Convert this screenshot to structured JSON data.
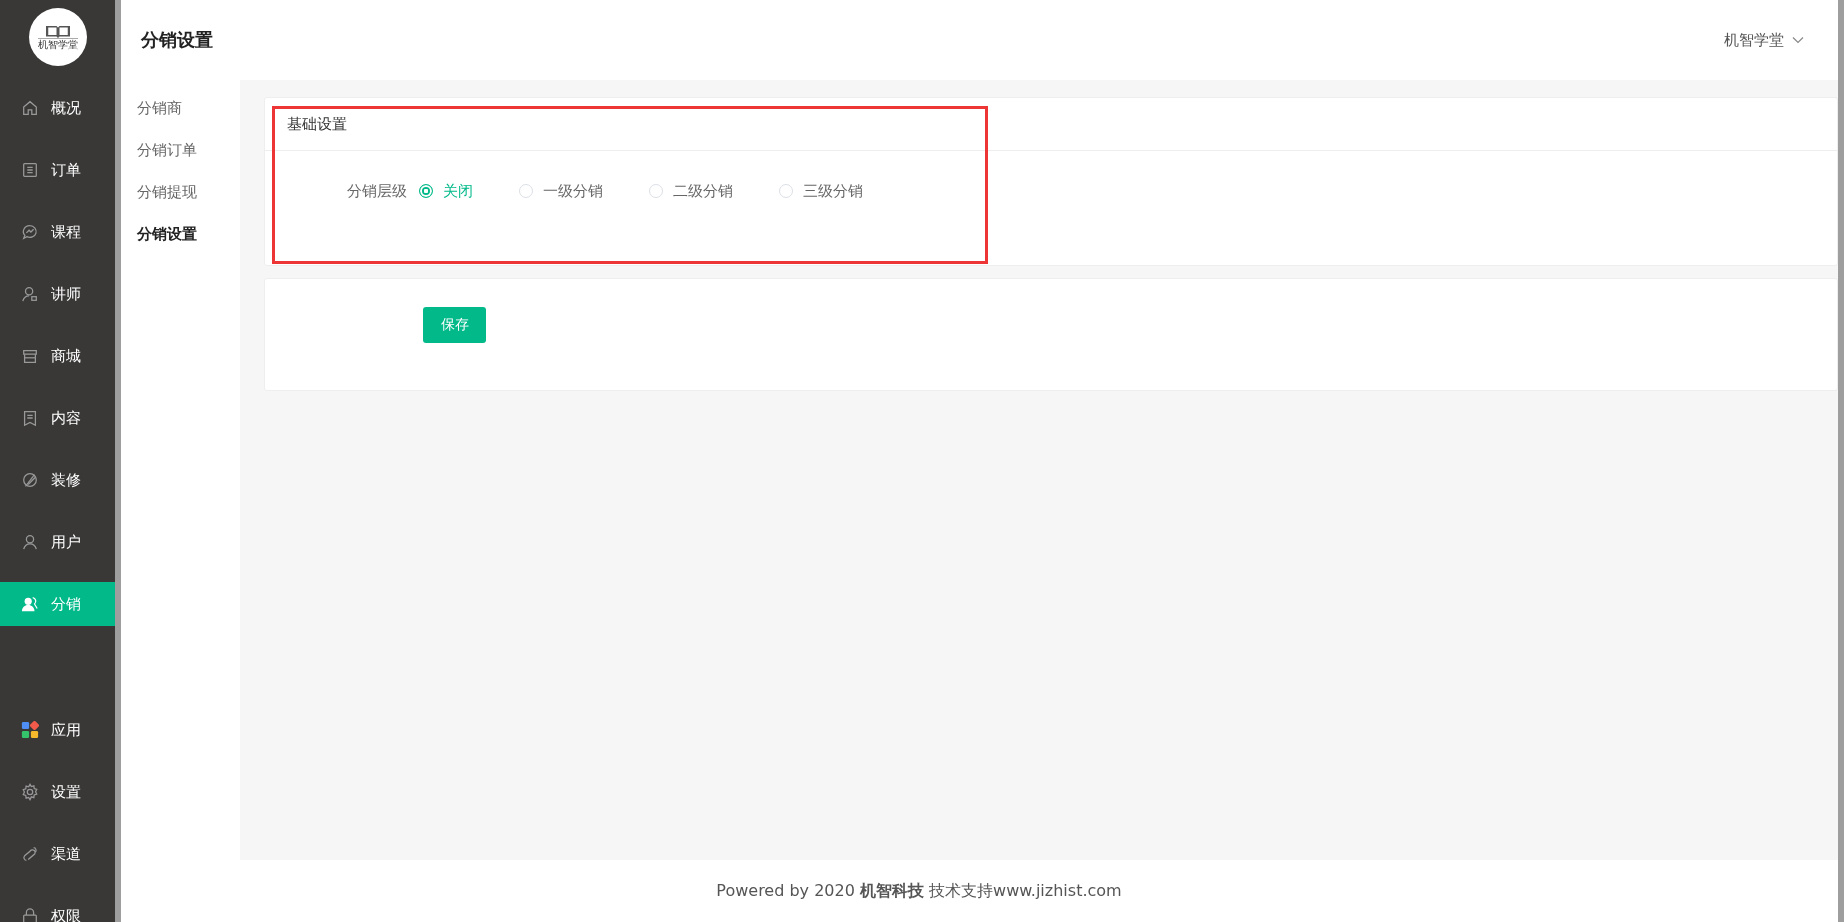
{
  "logo": {
    "text": "机智学堂"
  },
  "sidebar": {
    "items": [
      {
        "label": "概况",
        "selected": false
      },
      {
        "label": "订单",
        "selected": false
      },
      {
        "label": "课程",
        "selected": false
      },
      {
        "label": "讲师",
        "selected": false
      },
      {
        "label": "商城",
        "selected": false
      },
      {
        "label": "内容",
        "selected": false
      },
      {
        "label": "装修",
        "selected": false
      },
      {
        "label": "用户",
        "selected": false
      },
      {
        "label": "分销",
        "selected": true
      }
    ],
    "bottom_items": [
      {
        "label": "应用",
        "selected": false
      },
      {
        "label": "设置",
        "selected": false
      },
      {
        "label": "渠道",
        "selected": false
      },
      {
        "label": "权限",
        "selected": false
      }
    ]
  },
  "header": {
    "title": "分销设置",
    "account": "机智学堂"
  },
  "subnav": {
    "items": [
      {
        "label": "分销商",
        "selected": false
      },
      {
        "label": "分销订单",
        "selected": false
      },
      {
        "label": "分销提现",
        "selected": false
      },
      {
        "label": "分销设置",
        "selected": true
      }
    ]
  },
  "basic_settings": {
    "title": "基础设置",
    "field_label": "分销层级",
    "options": [
      {
        "label": "关闭",
        "selected": true
      },
      {
        "label": "一级分销",
        "selected": false
      },
      {
        "label": "二级分销",
        "selected": false
      },
      {
        "label": "三级分销",
        "selected": false
      }
    ],
    "highlighted": true
  },
  "save_button": "保存",
  "footer": "Powered by 2020 **机智科技** 技术支持www.jizhist.com"
}
